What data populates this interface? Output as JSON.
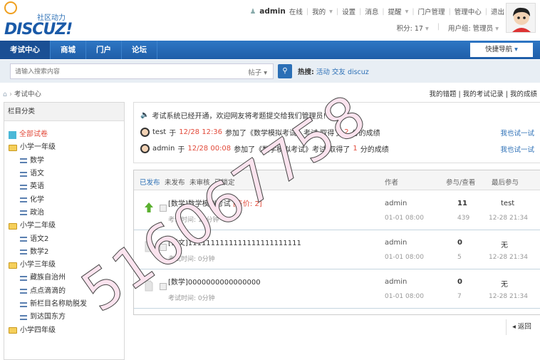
{
  "header": {
    "slogan": "社区动力",
    "brand": "DISCUZ!",
    "user": "admin",
    "status": "在线",
    "links": [
      "我的",
      "设置",
      "消息",
      "提醒",
      "门户管理",
      "管理中心",
      "退出"
    ],
    "points_label": "积分: 17",
    "group_label": "用户组: 管理员"
  },
  "nav": {
    "items": [
      "考试中心",
      "商城",
      "门户",
      "论坛"
    ],
    "quick": "快捷导航"
  },
  "search": {
    "placeholder": "请输入搜索内容",
    "type": "帖子",
    "hot_label": "热搜:",
    "hot": [
      "活动",
      "交友",
      "discuz"
    ]
  },
  "breadcrumb": {
    "current": "考试中心"
  },
  "mylinks": [
    "我的错题",
    "我的考试记录",
    "我的成绩"
  ],
  "sidebar": {
    "title": "栏目分类",
    "items": [
      {
        "label": "全部试卷",
        "kind": "all"
      },
      {
        "label": "小学一年级",
        "kind": "folder"
      },
      {
        "label": "数学",
        "kind": "sub"
      },
      {
        "label": "语文",
        "kind": "sub"
      },
      {
        "label": "英语",
        "kind": "sub"
      },
      {
        "label": "化学",
        "kind": "sub"
      },
      {
        "label": "政治",
        "kind": "sub"
      },
      {
        "label": "小学二年级",
        "kind": "folder"
      },
      {
        "label": "语文2",
        "kind": "sub"
      },
      {
        "label": "数学2",
        "kind": "sub"
      },
      {
        "label": "小学三年级",
        "kind": "folder"
      },
      {
        "label": "藏族自治州",
        "kind": "sub"
      },
      {
        "label": "点点滴滴的",
        "kind": "sub"
      },
      {
        "label": "新栏目名称助脱发",
        "kind": "sub"
      },
      {
        "label": "到达国东方",
        "kind": "sub"
      },
      {
        "label": "小学四年级",
        "kind": "folder"
      }
    ]
  },
  "announcement": {
    "notice": "考试系统已经开通，欢迎网友将考题提交给我们管理员!",
    "records": [
      {
        "user": "test",
        "pre": "于",
        "time": "12/28 12:36",
        "mid": "参加了《数学模拟考试》考试,取得了",
        "score": "2",
        "post": "分的成绩",
        "try": "我也试一试"
      },
      {
        "user": "admin",
        "pre": "于",
        "time": "12/28 00:08",
        "mid": "参加了《数学模拟考试》考试,取得了",
        "score": "1",
        "post": "分的成绩",
        "try": "我也试一试"
      }
    ]
  },
  "list": {
    "filters": [
      "已发布",
      "未发布",
      "未审核",
      "已锁定"
    ],
    "col_author": "作者",
    "col_stats": "参与/查看",
    "col_last": "最后参与",
    "rows": [
      {
        "title": "[数学]数学模拟考试",
        "price": "[售价: 2]",
        "duration": "考试时间: 10分钟",
        "author": "admin",
        "date": "01-01 08:00",
        "joined": "11",
        "views": "439",
        "last_user": "test",
        "last_time": "12-28 21:34",
        "icon": "up-arrow"
      },
      {
        "title": "[语文]1111111111111111111111111",
        "price": "",
        "duration": "考试时间: 0分钟",
        "author": "admin",
        "date": "01-01 08:00",
        "joined": "0",
        "views": "5",
        "last_user": "无",
        "last_time": "12-28 21:34",
        "icon": "doc"
      },
      {
        "title": "[数学]0000000000000000",
        "price": "",
        "duration": "考试时间: 0分钟",
        "author": "admin",
        "date": "01-01 08:00",
        "joined": "0",
        "views": "7",
        "last_user": "无",
        "last_time": "12-28 21:34",
        "icon": "doc"
      }
    ]
  },
  "back": "返回",
  "watermark": "516067758"
}
